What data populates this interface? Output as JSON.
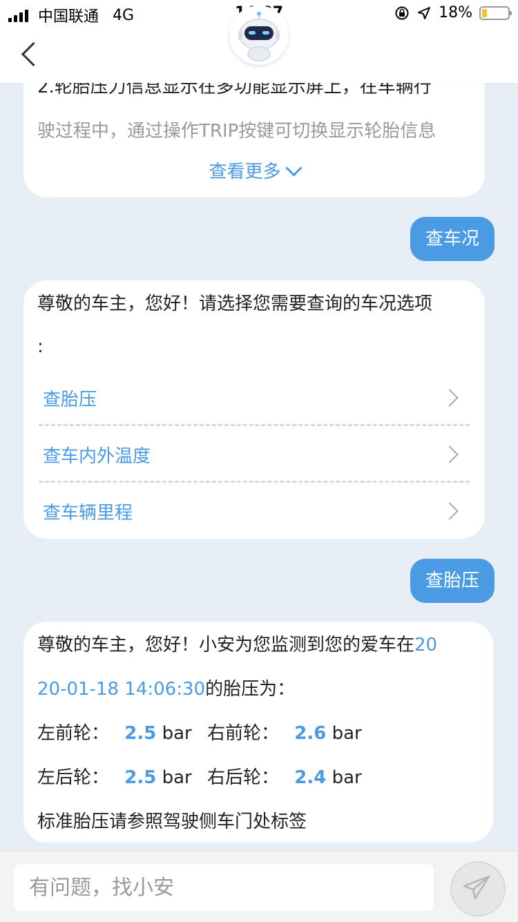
{
  "status_bar": {
    "carrier": "中国联通",
    "network": "4G",
    "time": "14:07",
    "battery": "18%",
    "battery_level": 0.18,
    "icons": [
      "signal-icon",
      "rotation-lock-icon",
      "location-arrow-icon",
      "battery-icon"
    ]
  },
  "nav": {
    "back_icon": "back-chevron-icon",
    "avatar_icon": "robot-avatar-icon"
  },
  "messages": {
    "first": {
      "line1": "2.轮胎压力信息显示在多功能显示屏上，在车辆行",
      "line2": "驶过程中，通过操作TRIP按键可切换显示轮胎信息",
      "more": "查看更多"
    },
    "user1": "查车况",
    "menu": {
      "line1": "尊敬的车主，您好！请选择您需要查询的车况选项",
      "line2": ":",
      "options": [
        {
          "label": "查胎压"
        },
        {
          "label": "查车内外温度"
        },
        {
          "label": "查车辆里程"
        }
      ]
    },
    "user2": "查胎压",
    "tire": {
      "intro_a": "尊敬的车主，您好！小安为您监测到您的爱车在",
      "intro_b": "20",
      "date_rest": "20-01-18 14:06:30",
      "intro_c": "的胎压为：",
      "front_left_label": "左前轮：",
      "front_left_value": "2.5",
      "front_right_label": "右前轮：",
      "front_right_value": "2.6",
      "rear_left_label": "左后轮：",
      "rear_left_value": "2.5",
      "rear_right_label": "右后轮：",
      "rear_right_value": "2.4",
      "unit": "bar",
      "note": "标准胎压请参照驾驶侧车门处标签"
    }
  },
  "input": {
    "placeholder": "有问题，找小安"
  },
  "colors": {
    "accent": "#4a9be3",
    "background": "#e8eef5",
    "battery": "#f5c13d"
  }
}
